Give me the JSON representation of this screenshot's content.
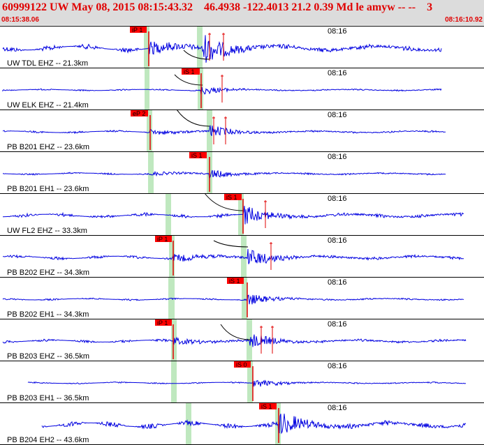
{
  "header": {
    "title": "60999122 UW May 08, 2015 08:15:43.32    46.4938 -122.4013 21.2 0.39 Md le amyw -- --    3",
    "start_time": "08:15:38.06",
    "end_time": "08:16:10.92"
  },
  "colors": {
    "header_bg": "#dcdcdc",
    "header_text": "#e00000",
    "trace": "#0000e0",
    "pick_box": "#ff0000",
    "pick_line": "#e00000",
    "window_band": "#bfe8bf",
    "predicted_curve": "#000000"
  },
  "panels": [
    {
      "label": "UW TDL EHZ -- 21.3km",
      "time": "08:16",
      "pick": "iP 1",
      "pick_type": "P"
    },
    {
      "label": "UW ELK EHZ -- 21.4km",
      "time": "08:16",
      "pick": "iS 1",
      "pick_type": "S"
    },
    {
      "label": "PB B201 EHZ -- 23.6km",
      "time": "08:16",
      "pick": "eP 2",
      "pick_type": "P"
    },
    {
      "label": "PB B201 EH1 -- 23.6km",
      "time": "08:16",
      "pick": "iS 1",
      "pick_type": "S"
    },
    {
      "label": "UW FL2 EHZ -- 33.3km",
      "time": "08:16",
      "pick": "iS 1",
      "pick_type": "S"
    },
    {
      "label": "PB B202 EHZ -- 34.3km",
      "time": "08:16",
      "pick": "iP 1",
      "pick_type": "P"
    },
    {
      "label": "PB B202 EH1 -- 34.3km",
      "time": "08:16",
      "pick": "iS 1",
      "pick_type": "S"
    },
    {
      "label": "PB B203 EHZ -- 36.5km",
      "time": "08:16",
      "pick": "iP 1",
      "pick_type": "P"
    },
    {
      "label": "PB B203 EH1 -- 36.5km",
      "time": "08:16",
      "pick": "iS 0",
      "pick_type": "S"
    },
    {
      "label": "PB B204 EH2 -- 43.6km",
      "time": "08:16",
      "pick": "iS 1",
      "pick_type": "S"
    }
  ]
}
